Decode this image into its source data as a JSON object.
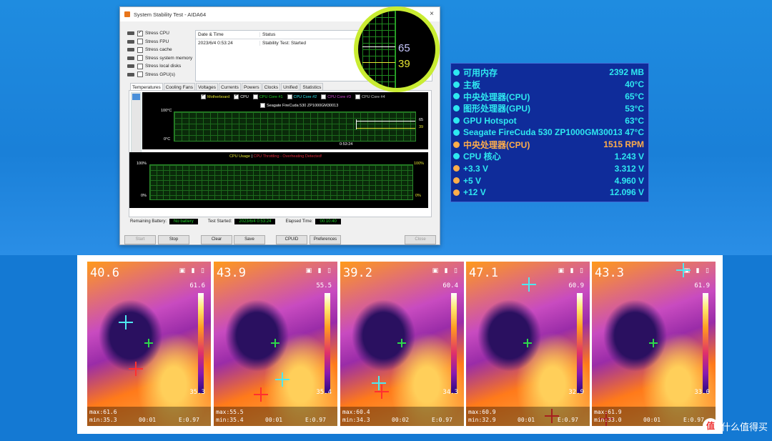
{
  "window": {
    "title": "System Stability Test - AIDA64",
    "close_glyph": "×",
    "stress": [
      {
        "label": "Stress CPU",
        "checked": true
      },
      {
        "label": "Stress FPU",
        "checked": false
      },
      {
        "label": "Stress cache",
        "checked": false
      },
      {
        "label": "Stress system memory",
        "checked": false
      },
      {
        "label": "Stress local disks",
        "checked": false
      },
      {
        "label": "Stress GPU(s)",
        "checked": false
      }
    ],
    "log": {
      "col_date": "Date & Time",
      "col_status": "Status",
      "row_date": "2023/6/4 0:53:24",
      "row_status": "Stability Test: Started"
    },
    "tabs": [
      "Temperatures",
      "Cooling Fans",
      "Voltages",
      "Currents",
      "Powers",
      "Clocks",
      "Unified",
      "Statistics"
    ],
    "graph1": {
      "legend": [
        {
          "label": "Motherboard",
          "color": "#e6e632",
          "checked": true
        },
        {
          "label": "CPU",
          "color": "#ffffff",
          "checked": true
        },
        {
          "label": "CPU Core #1",
          "color": "#21d32a",
          "checked": false
        },
        {
          "label": "CPU Core #2",
          "color": "#2ee8f0",
          "checked": false
        },
        {
          "label": "CPU Core #3",
          "color": "#d84ad8",
          "checked": false
        },
        {
          "label": "CPU Core #4",
          "color": "#cccccc",
          "checked": false
        }
      ],
      "disk": "Seagate FireCuda 530 ZP1000GM30013",
      "ymax": "100°C",
      "ymin": "0°C",
      "time": "0:53:24",
      "val_cpu": "65",
      "val_mb": "39"
    },
    "graph2": {
      "caption_a": "CPU Usage",
      "caption_sep": "|",
      "caption_b": "CPU Throttling - Overheating Detected!",
      "left_top": "100%",
      "left_bot": "0%",
      "right_top": "100%",
      "right_bot": "0%"
    },
    "info": {
      "battery_label": "Remaining Battery:",
      "battery": "No battery",
      "started_label": "Test Started:",
      "started": "2023/6/4 0:53:24",
      "elapsed_label": "Elapsed Time:",
      "elapsed": "00:10:40"
    },
    "buttons": {
      "start": "Start",
      "stop": "Stop",
      "clear": "Clear",
      "save": "Save",
      "cpuid": "CPUID",
      "prefs": "Preferences",
      "close": "Close"
    }
  },
  "magnifier": {
    "v1": "65",
    "v2": "39"
  },
  "sensors": [
    {
      "label": "可用内存",
      "value": "2392 MB",
      "color": "#2ee8f0",
      "icon": "memory-icon"
    },
    {
      "label": "主板",
      "value": "40°C",
      "color": "#2ee8f0",
      "icon": "motherboard-icon"
    },
    {
      "label": "中央处理器(CPU)",
      "value": "65°C",
      "color": "#2ee8f0",
      "icon": "cpu-icon"
    },
    {
      "label": "图形处理器(GPU)",
      "value": "53°C",
      "color": "#2ee8f0",
      "icon": "gpu-icon"
    },
    {
      "label": "GPU Hotspot",
      "value": "63°C",
      "color": "#2ee8f0",
      "icon": "gpu-icon"
    },
    {
      "label": "Seagate FireCuda 530 ZP1000GM30013",
      "value": "47°C",
      "color": "#2ee8f0",
      "icon": "disk-icon"
    },
    {
      "label": "中央处理器(CPU)",
      "value": "1515 RPM",
      "color": "#ffad4a",
      "icon": "fan-icon"
    },
    {
      "label": "CPU 核心",
      "value": "1.243 V",
      "color": "#2ee8f0",
      "icon": "voltage-icon"
    },
    {
      "label": "+3.3 V",
      "value": "3.312 V",
      "color": "#2ee8f0",
      "icon": "voltage-icon"
    },
    {
      "label": "+5 V",
      "value": "4.960 V",
      "color": "#2ee8f0",
      "icon": "voltage-icon"
    },
    {
      "label": "+12 V",
      "value": "12.096 V",
      "color": "#2ee8f0",
      "icon": "voltage-icon"
    }
  ],
  "thermal": [
    {
      "big": "40.6",
      "max": "61.6",
      "min": "35.3",
      "fmax": "max:61.6",
      "fmin": "min:35.3",
      "t": "00:01",
      "e": "E:0.97"
    },
    {
      "big": "43.9",
      "max": "55.5",
      "min": "35.4",
      "fmax": "max:55.5",
      "fmin": "min:35.4",
      "t": "00:01",
      "e": "E:0.97"
    },
    {
      "big": "39.2",
      "max": "60.4",
      "min": "34.3",
      "fmax": "max:60.4",
      "fmin": "min:34.3",
      "t": "00:02",
      "e": "E:0.97"
    },
    {
      "big": "47.1",
      "max": "60.9",
      "min": "32.9",
      "fmax": "max:60.9",
      "fmin": "min:32.9",
      "t": "00:01",
      "e": "E:0.97"
    },
    {
      "big": "43.3",
      "max": "61.9",
      "min": "33.0",
      "fmax": "max:61.9",
      "fmin": "min:33.0",
      "t": "00:01",
      "e": "E:0.97"
    }
  ],
  "watermark": {
    "logo": "值",
    "text": "什么值得买"
  }
}
